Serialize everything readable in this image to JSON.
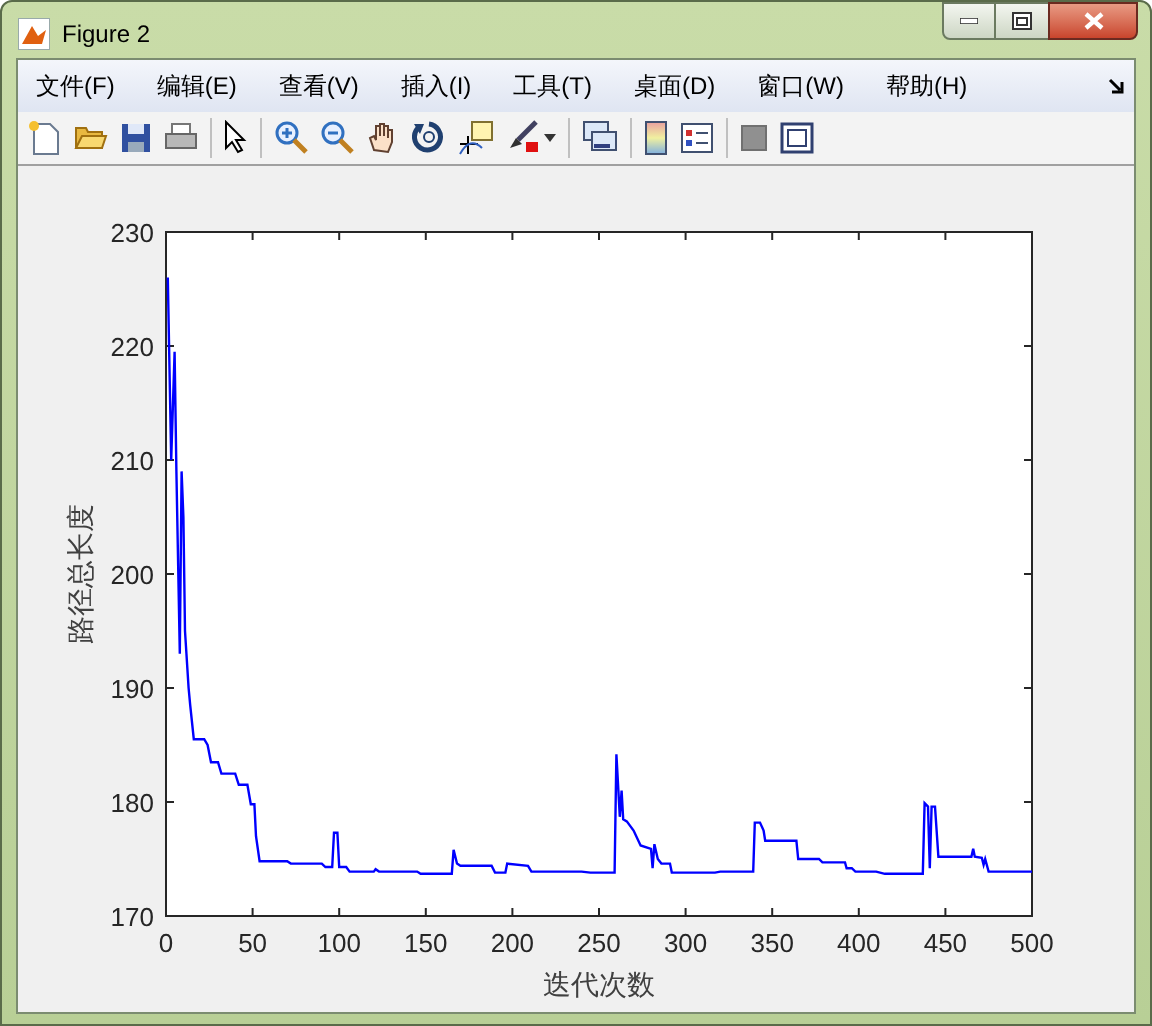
{
  "window": {
    "title": "Figure 2"
  },
  "menu": [
    {
      "label": "文件(F)"
    },
    {
      "label": "编辑(E)"
    },
    {
      "label": "查看(V)"
    },
    {
      "label": "插入(I)"
    },
    {
      "label": "工具(T)"
    },
    {
      "label": "桌面(D)"
    },
    {
      "label": "窗口(W)"
    },
    {
      "label": "帮助(H)"
    }
  ],
  "figure": {
    "chart_data": {
      "type": "line",
      "xlabel": "迭代次数",
      "ylabel": "路径总长度",
      "xlim": [
        0,
        500
      ],
      "ylim": [
        170,
        230
      ],
      "xticks": [
        0,
        50,
        100,
        150,
        200,
        250,
        300,
        350,
        400,
        450,
        500
      ],
      "yticks": [
        170,
        180,
        190,
        200,
        210,
        220,
        230
      ],
      "x": [
        1,
        3,
        5,
        6,
        8,
        9,
        10,
        11,
        13,
        14,
        16,
        22,
        24,
        26,
        30,
        32,
        40,
        42,
        47,
        49,
        51,
        52,
        54,
        70,
        72,
        90,
        92,
        96,
        97,
        99,
        100,
        104,
        106,
        120,
        121,
        123,
        145,
        147,
        165,
        166,
        168,
        170,
        188,
        190,
        196,
        197,
        209,
        211,
        240,
        245,
        259,
        260,
        262,
        263,
        264,
        266,
        270,
        274,
        280,
        281,
        282,
        284,
        286,
        291,
        292,
        317,
        320,
        339,
        340,
        343,
        345,
        346,
        364,
        365,
        377,
        379,
        392,
        393,
        396,
        398,
        410,
        415,
        437,
        438,
        440,
        441,
        442,
        444,
        446,
        465,
        466,
        467,
        471,
        472,
        473,
        475,
        500
      ],
      "series": [
        {
          "color": "#0000ff",
          "values": [
            226,
            210,
            219.5,
            209,
            193,
            209,
            205,
            195,
            190,
            188.5,
            185.5,
            185.5,
            185,
            183.5,
            183.5,
            182.5,
            182.5,
            181.5,
            181.5,
            179.8,
            179.8,
            177,
            174.8,
            174.8,
            174.6,
            174.6,
            174.3,
            174.3,
            177.3,
            177.3,
            174.3,
            174.3,
            173.9,
            173.9,
            174.1,
            173.9,
            173.9,
            173.7,
            173.7,
            175.8,
            174.6,
            174.4,
            174.4,
            173.8,
            173.8,
            174.6,
            174.4,
            173.9,
            173.9,
            173.8,
            173.8,
            184.2,
            178.7,
            181,
            178.5,
            178.3,
            177.5,
            176.2,
            175.9,
            174.2,
            176.3,
            175,
            174.6,
            174.6,
            173.8,
            173.8,
            173.9,
            173.9,
            178.2,
            178.2,
            177.5,
            176.6,
            176.6,
            175,
            175,
            174.7,
            174.7,
            174.2,
            174.2,
            173.9,
            173.9,
            173.7,
            173.7,
            179.9,
            179.6,
            174.2,
            179.6,
            179.6,
            175.2,
            175.2,
            175.9,
            175.2,
            175.1,
            174.5,
            175,
            173.9,
            173.9
          ]
        }
      ]
    }
  }
}
